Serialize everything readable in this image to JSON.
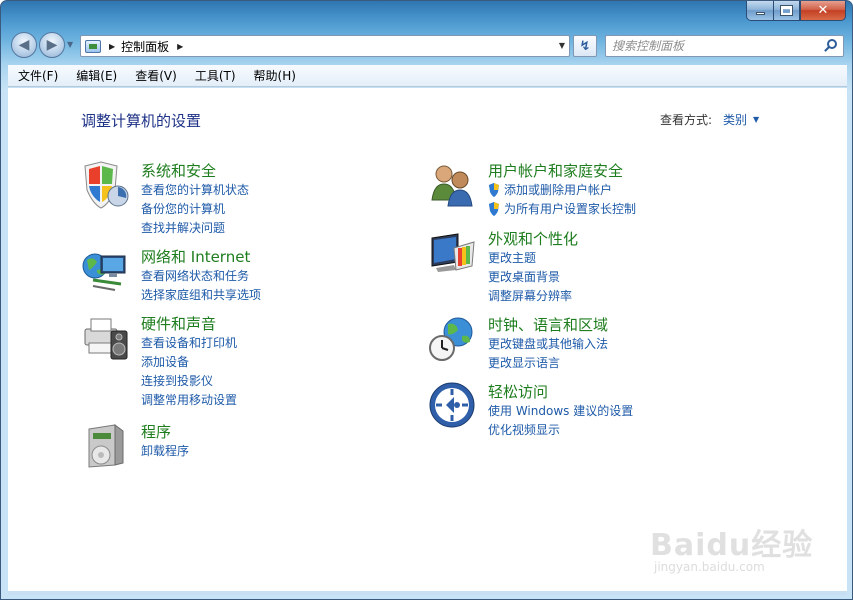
{
  "window": {
    "buttons": {
      "minimize": "minimize",
      "maximize": "maximize",
      "close": "✕"
    }
  },
  "address_bar": {
    "path": "控制面板",
    "search_placeholder": "搜索控制面板"
  },
  "menu": [
    "文件(F)",
    "编辑(E)",
    "查看(V)",
    "工具(T)",
    "帮助(H)"
  ],
  "content": {
    "title": "调整计算机的设置",
    "view_by_label": "查看方式:",
    "view_by_value": "类别"
  },
  "categories": {
    "system": {
      "title": "系统和安全",
      "links": [
        "查看您的计算机状态",
        "备份您的计算机",
        "查找并解决问题"
      ]
    },
    "network": {
      "title": "网络和 Internet",
      "links": [
        "查看网络状态和任务",
        "选择家庭组和共享选项"
      ]
    },
    "hardware": {
      "title": "硬件和声音",
      "links": [
        "查看设备和打印机",
        "添加设备",
        "连接到投影仪",
        "调整常用移动设置"
      ]
    },
    "programs": {
      "title": "程序",
      "links": [
        "卸载程序"
      ]
    },
    "users": {
      "title": "用户帐户和家庭安全",
      "links": [
        "添加或删除用户帐户",
        "为所有用户设置家长控制"
      ]
    },
    "appearance": {
      "title": "外观和个性化",
      "links": [
        "更改主题",
        "更改桌面背景",
        "调整屏幕分辨率"
      ]
    },
    "clock": {
      "title": "时钟、语言和区域",
      "links": [
        "更改键盘或其他输入法",
        "更改显示语言"
      ]
    },
    "ease": {
      "title": "轻松访问",
      "links": [
        "使用 Windows 建议的设置",
        "优化视频显示"
      ]
    }
  },
  "watermark": {
    "main": "Baidu经验",
    "sub": "jingyan.baidu.com"
  },
  "colors": {
    "link": "#1e5aa8",
    "category_title": "#1e7d1e",
    "page_title": "#1e3287"
  }
}
